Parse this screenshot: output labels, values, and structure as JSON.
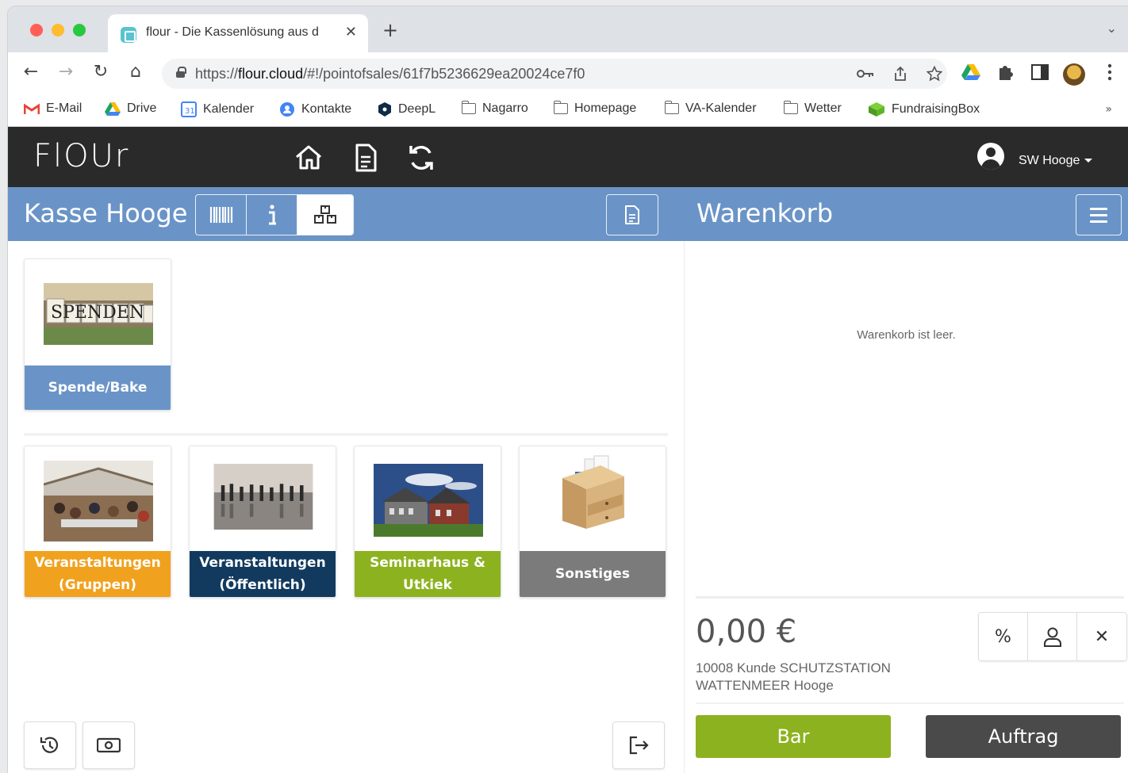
{
  "browser": {
    "tab_title": "flour - Die Kassenlösung aus d",
    "tab_close": "✕",
    "new_tab": "+",
    "tab_list": "⌄",
    "back": "←",
    "forward": "→",
    "reload": "↻",
    "home": "⌂",
    "url_prefix": "https://",
    "url_host": "flour.cloud",
    "url_path": "/#!/pointofsales/61f7b5236629ea20024ce7f0",
    "bookmarks": [
      "E-Mail",
      "Drive",
      "Kalender",
      "Kontakte",
      "DeepL",
      "Nagarro",
      "Homepage",
      "VA-Kalender",
      "Wetter",
      "FundraisingBox"
    ],
    "bookmarks_more": "»"
  },
  "app": {
    "logo": "FlOUr",
    "user": "SW Hooge",
    "pos_title": "Kasse Hooge",
    "cart_title": "Warenkorb"
  },
  "tiles_top": [
    {
      "label": "Spende/Bake",
      "color": "#6a94c7"
    }
  ],
  "tiles": [
    {
      "label": "Veranstaltungen (Gruppen)",
      "color": "#f0a11e"
    },
    {
      "label": "Veranstaltungen (Öffentlich)",
      "color": "#123a5f"
    },
    {
      "label": "Seminarhaus & Utkiek",
      "color": "#8cb21f"
    },
    {
      "label": "Sonstiges",
      "color": "#7b7b7b"
    }
  ],
  "cart": {
    "empty_message": "Warenkorb ist leer.",
    "total": "0,00 €",
    "customer": "10008 Kunde SCHUTZSTATION WATTENMEER Hooge",
    "discount_symbol": "%",
    "clear_symbol": "✕",
    "pay_cash": "Bar",
    "order": "Auftrag"
  },
  "image_text": {
    "spenden": "SPENDEN"
  }
}
